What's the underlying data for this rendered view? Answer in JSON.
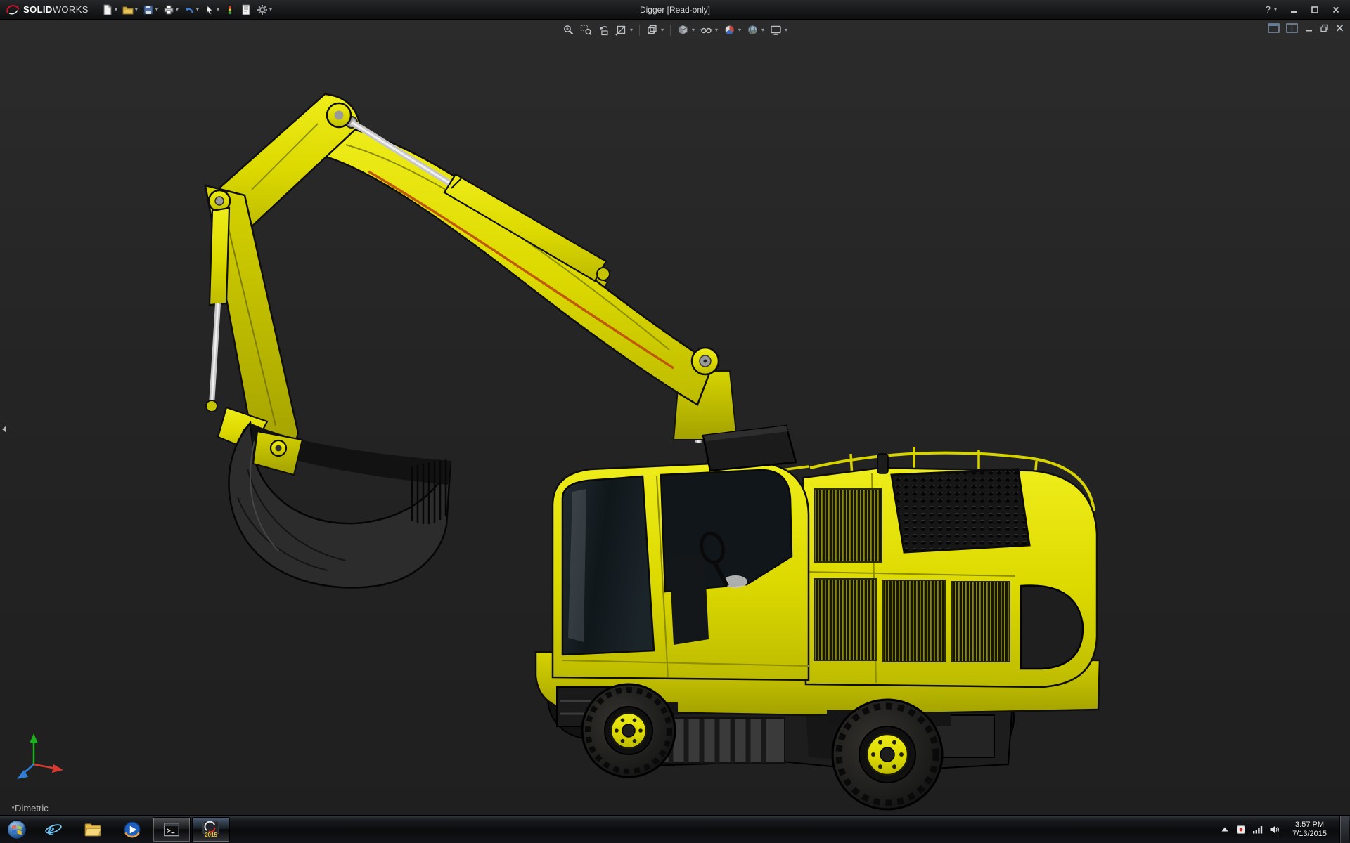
{
  "app": {
    "brand_bold": "SOLID",
    "brand_light": "WORKS",
    "title": "Digger [Read-only]",
    "help_label": "?"
  },
  "glyphs": {
    "chevron": "▾"
  },
  "viewport": {
    "view_label": "*Dimetric",
    "model": "Digger — yellow wheeled excavator 3D model"
  },
  "colors": {
    "model_yellow": "#dcd900",
    "model_yellow_dark": "#a3a100",
    "orange_stripe": "#c05a00",
    "viewport_bg": "#242424",
    "titlebar_bg": "#141618",
    "taskbar_bg": "#101214"
  },
  "icons": {
    "titlebar_tools": [
      "new-document",
      "open",
      "save",
      "print",
      "undo",
      "select",
      "rebuild",
      "file-properties",
      "options"
    ],
    "headsup_tools": [
      "zoom-to-fit",
      "zoom-to-area",
      "previous-view",
      "section-view",
      "view-orientation",
      "display-style",
      "hide-show-items",
      "edit-appearance",
      "apply-scene",
      "view-settings"
    ],
    "doc_window_controls": [
      "pane-layout-1",
      "pane-layout-2",
      "minimize",
      "restore",
      "close"
    ],
    "titlebar_window_controls": [
      "help",
      "minimize",
      "maximize",
      "close"
    ],
    "tray_icons": [
      "hidden-icons",
      "tray-app",
      "network",
      "volume"
    ],
    "taskbar_apps": [
      "start",
      "internet-explorer",
      "file-explorer",
      "media-player",
      "command-prompt",
      "solidworks-2015"
    ]
  },
  "taskbar": {
    "clock": {
      "time": "3:57 PM",
      "date": "7/13/2015"
    },
    "sw_year": "2015"
  }
}
